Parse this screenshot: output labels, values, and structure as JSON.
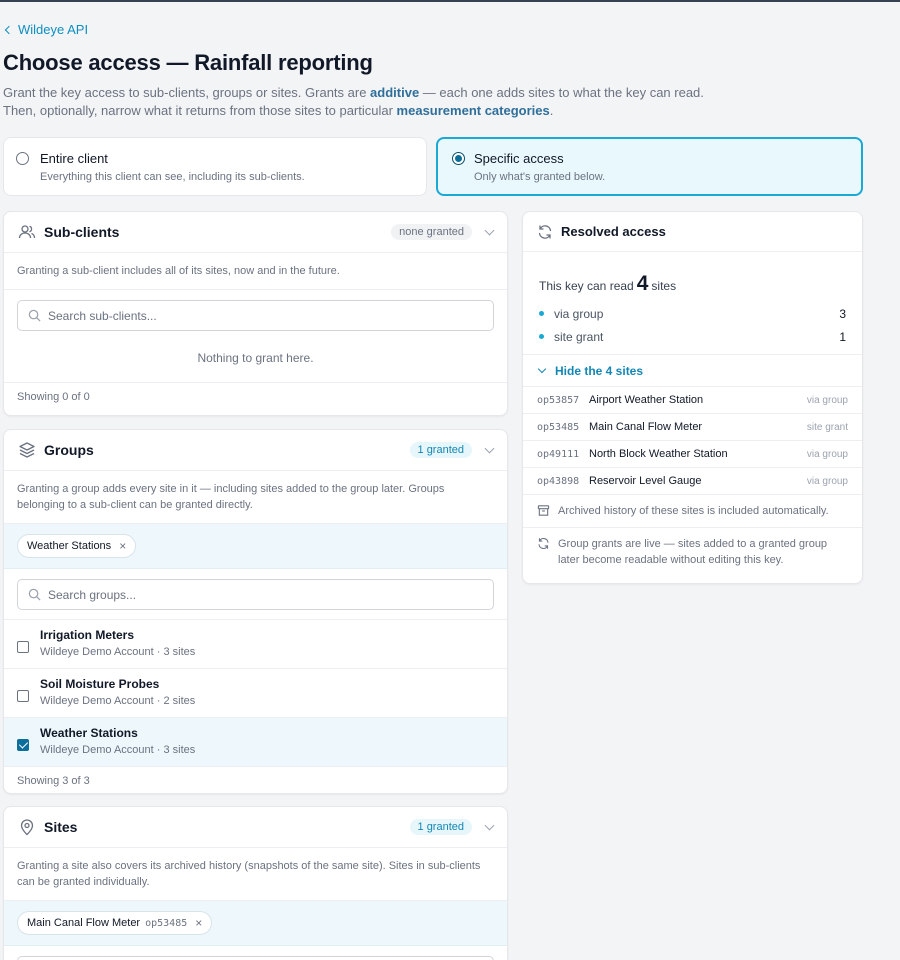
{
  "nav": {
    "back_label": "Wildeye API"
  },
  "page": {
    "title": "Choose access — Rainfall reporting",
    "intro_1a": "Grant the key access to sub-clients, groups or sites. Grants are ",
    "intro_1b": "additive",
    "intro_1c": " — each one adds sites to what the key can read.",
    "intro_2a": "Then, optionally, narrow what it returns from those sites to particular ",
    "intro_2b": "measurement categories",
    "intro_2c": "."
  },
  "modes": {
    "entire": {
      "title": "Entire client",
      "desc": "Everything this client can see, including its sub-clients.",
      "selected": false
    },
    "specific": {
      "title": "Specific access",
      "desc": "Only what's granted below.",
      "selected": true
    }
  },
  "subclients": {
    "title": "Sub-clients",
    "badge": "none granted",
    "desc": "Granting a sub-client includes all of its sites, now and in the future.",
    "search_placeholder": "Search sub-clients...",
    "empty": "Nothing to grant here.",
    "footer": "Showing 0 of 0"
  },
  "groups": {
    "title": "Groups",
    "badge": "1 granted",
    "desc": "Granting a group adds every site in it — including sites added to the group later. Groups belonging to a sub-client can be granted directly.",
    "chip": "Weather Stations",
    "search_placeholder": "Search groups...",
    "items": [
      {
        "name": "Irrigation Meters",
        "meta": "Wildeye Demo Account · 3 sites",
        "checked": false
      },
      {
        "name": "Soil Moisture Probes",
        "meta": "Wildeye Demo Account · 2 sites",
        "checked": false
      },
      {
        "name": "Weather Stations",
        "meta": "Wildeye Demo Account · 3 sites",
        "checked": true
      }
    ],
    "footer": "Showing 3 of 3"
  },
  "sites": {
    "title": "Sites",
    "badge": "1 granted",
    "desc": "Granting a site also covers its archived history (snapshots of the same site). Sites in sub-clients can be granted individually.",
    "chip_name": "Main Canal Flow Meter",
    "chip_code": "op53485"
  },
  "resolved": {
    "title": "Resolved access",
    "sum_pre": "This key can read",
    "count": "4",
    "sum_post": "sites",
    "breakdown": [
      {
        "label": "via group",
        "count": "3"
      },
      {
        "label": "site grant",
        "count": "1"
      }
    ],
    "toggle": "Hide the 4 sites",
    "sites": [
      {
        "code": "op53857",
        "name": "Airport Weather Station",
        "source": "via group"
      },
      {
        "code": "op53485",
        "name": "Main Canal Flow Meter",
        "source": "site grant"
      },
      {
        "code": "op49111",
        "name": "North Block Weather Station",
        "source": "via group"
      },
      {
        "code": "op43898",
        "name": "Reservoir Level Gauge",
        "source": "via group"
      }
    ],
    "note_archive": "Archived history of these sites is included automatically.",
    "note_live": "Group grants are live — sites added to a granted group later become readable without editing this key."
  },
  "colors": {
    "accent": "#1aa8d4",
    "link": "#0e8fc2",
    "selected_bg": "#e9f8fc"
  }
}
